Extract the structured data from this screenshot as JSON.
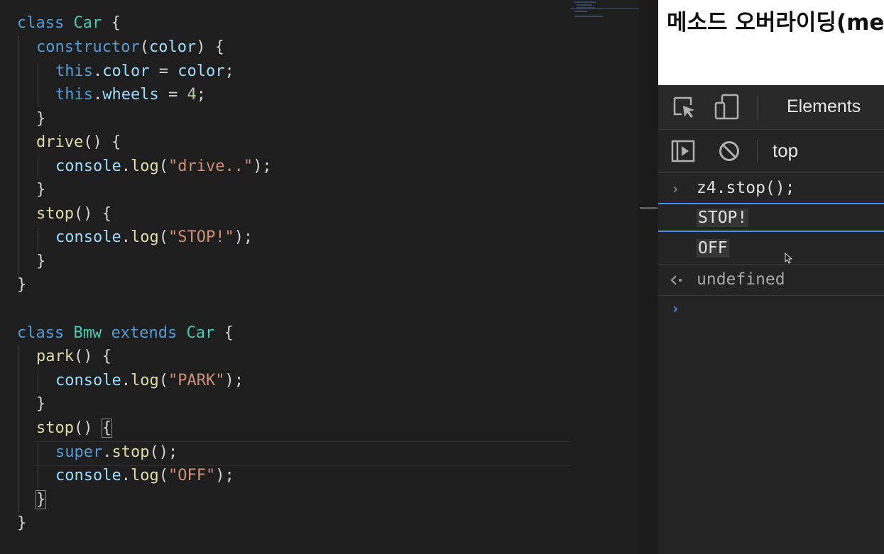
{
  "code": {
    "lines": [
      [
        "class",
        " ",
        "Car",
        " {"
      ],
      [
        "constructor",
        "(",
        "color",
        ") {"
      ],
      [
        "this",
        ".",
        "color",
        " = ",
        "color",
        ";"
      ],
      [
        "this",
        ".",
        "wheels",
        " = ",
        "4",
        ";"
      ],
      [
        "}"
      ],
      [
        "drive",
        "() {"
      ],
      [
        "console",
        ".",
        "log",
        "(",
        "\"drive..\"",
        ");"
      ],
      [
        "}"
      ],
      [
        "stop",
        "() {"
      ],
      [
        "console",
        ".",
        "log",
        "(",
        "\"STOP!\"",
        ");"
      ],
      [
        "}"
      ],
      [
        "}"
      ],
      [],
      [
        "class",
        " ",
        "Bmw",
        " ",
        "extends",
        " ",
        "Car",
        " {"
      ],
      [
        "park",
        "() {"
      ],
      [
        "console",
        ".",
        "log",
        "(",
        "\"PARK\"",
        ");"
      ],
      [
        "}"
      ],
      [
        "stop",
        "() ",
        "{"
      ],
      [
        "super",
        ".",
        "stop",
        "();"
      ],
      [
        "console",
        ".",
        "log",
        "(",
        "\"OFF\"",
        ");"
      ],
      [
        "}"
      ],
      [
        "}"
      ]
    ]
  },
  "page": {
    "heading": "메소드 오버라이딩(method overriding)"
  },
  "devtools": {
    "tab_elements": "Elements",
    "context": "top",
    "console": {
      "input": "z4.stop();",
      "outputs": [
        "STOP!",
        "OFF"
      ],
      "result": "undefined"
    }
  },
  "colors": {
    "keyword": "#569cd6",
    "class_name": "#4ec9b0",
    "function": "#dcdcaa",
    "variable": "#9cdcfe",
    "string": "#ce9178",
    "number": "#b5cea8",
    "prompt": "#4c8df6"
  },
  "icons": [
    "inspect-icon",
    "device-toolbar-icon",
    "sidebar-toggle-icon",
    "clear-console-icon",
    "chevron-right-icon",
    "return-arrow-icon",
    "mouse-cursor-icon"
  ]
}
